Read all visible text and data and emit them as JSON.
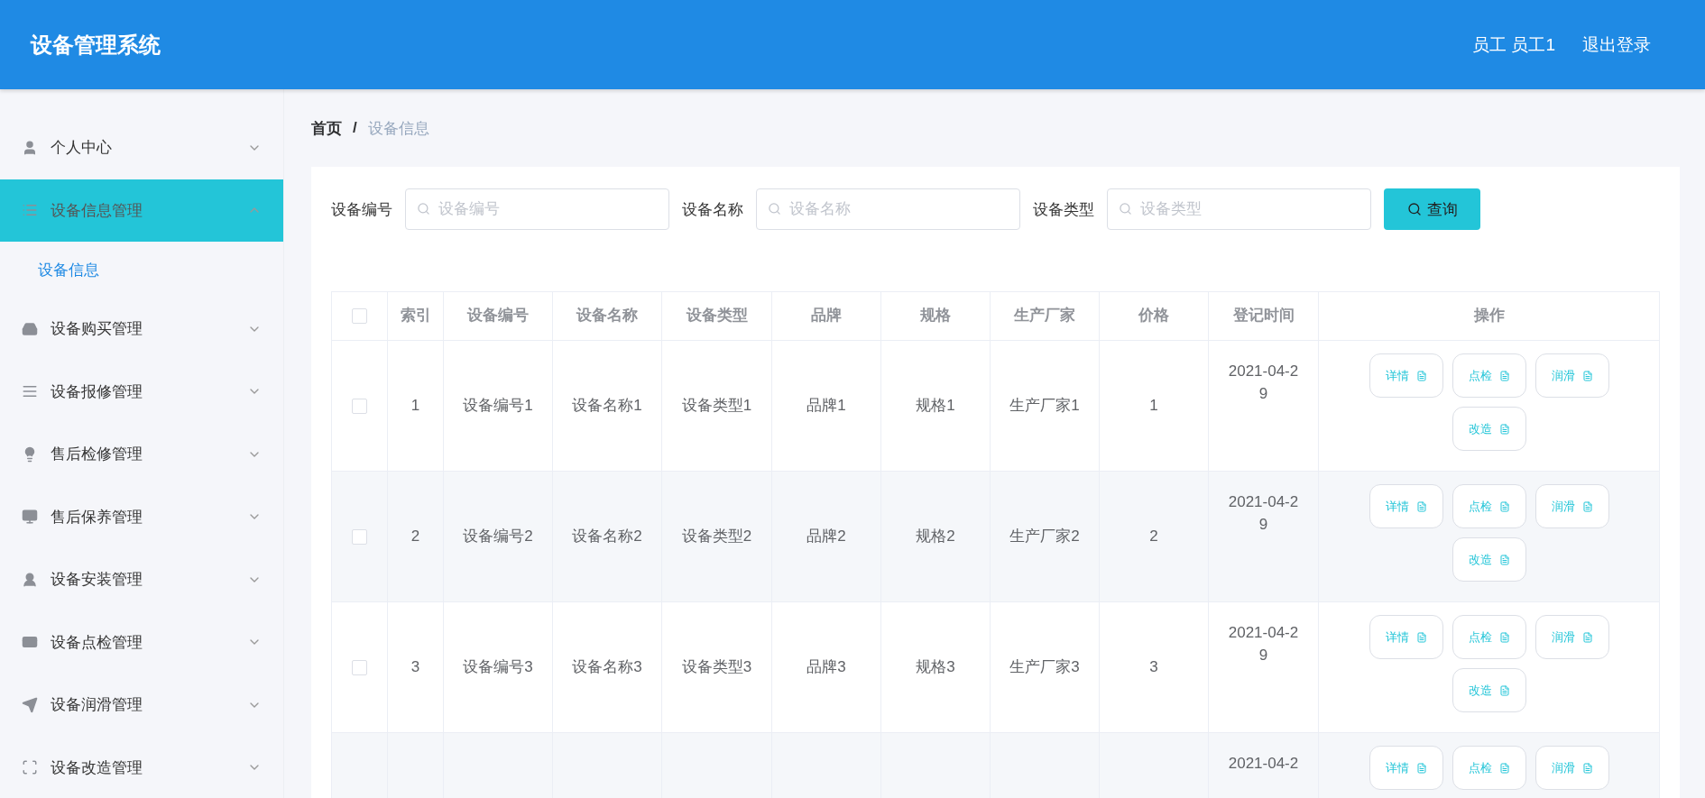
{
  "header": {
    "title": "设备管理系统",
    "user": "员工 员工1",
    "logout": "退出登录"
  },
  "sidebar": {
    "items": [
      {
        "kind": "user",
        "label": "个人中心",
        "selected": false,
        "expanded": false
      },
      {
        "kind": "list",
        "label": "设备信息管理",
        "selected": true,
        "expanded": true,
        "children": [
          {
            "label": "设备信息",
            "selected": true
          }
        ]
      },
      {
        "kind": "tray",
        "label": "设备购买管理",
        "selected": false,
        "expanded": false
      },
      {
        "kind": "lines",
        "label": "设备报修管理",
        "selected": false,
        "expanded": false
      },
      {
        "kind": "bulb",
        "label": "售后检修管理",
        "selected": false,
        "expanded": false
      },
      {
        "kind": "monitor",
        "label": "售后保养管理",
        "selected": false,
        "expanded": false
      },
      {
        "kind": "person",
        "label": "设备安装管理",
        "selected": false,
        "expanded": false
      },
      {
        "kind": "card",
        "label": "设备点检管理",
        "selected": false,
        "expanded": false
      },
      {
        "kind": "send",
        "label": "设备润滑管理",
        "selected": false,
        "expanded": false
      },
      {
        "kind": "scan",
        "label": "设备改造管理",
        "selected": false,
        "expanded": false
      }
    ]
  },
  "breadcrumb": {
    "separator": "/",
    "items": [
      "首页",
      "设备信息"
    ]
  },
  "search": {
    "fields": [
      {
        "label": "设备编号",
        "placeholder": "设备编号"
      },
      {
        "label": "设备名称",
        "placeholder": "设备名称"
      },
      {
        "label": "设备类型",
        "placeholder": "设备类型"
      }
    ],
    "button": "查询"
  },
  "table": {
    "all_checked": false,
    "columns": [
      "索引",
      "设备编号",
      "设备名称",
      "设备类型",
      "品牌",
      "规格",
      "生产厂家",
      "价格",
      "登记时间",
      "操作"
    ],
    "rows": [
      {
        "checked": false,
        "cells": [
          "1",
          "设备编号1",
          "设备名称1",
          "设备类型1",
          "品牌1",
          "规格1",
          "生产厂家1",
          "1"
        ],
        "time": "2021-04-29",
        "actions": [
          "详情",
          "点检",
          "润滑",
          "改造"
        ]
      },
      {
        "checked": false,
        "cells": [
          "2",
          "设备编号2",
          "设备名称2",
          "设备类型2",
          "品牌2",
          "规格2",
          "生产厂家2",
          "2"
        ],
        "time": "2021-04-29",
        "actions": [
          "详情",
          "点检",
          "润滑",
          "改造"
        ]
      },
      {
        "checked": false,
        "cells": [
          "3",
          "设备编号3",
          "设备名称3",
          "设备类型3",
          "品牌3",
          "规格3",
          "生产厂家3",
          "3"
        ],
        "time": "2021-04-29",
        "actions": [
          "详情",
          "点检",
          "润滑",
          "改造"
        ]
      },
      {
        "time": "2021-04-2",
        "actions": [
          "详情",
          "点检",
          "润滑"
        ]
      }
    ]
  }
}
